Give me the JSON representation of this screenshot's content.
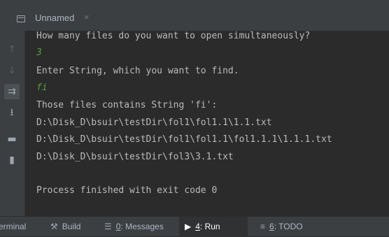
{
  "tab": {
    "title": "Unnamed",
    "close": "×"
  },
  "console": {
    "lines": [
      "How many files do you want to open simultaneously?",
      "3",
      "Enter String, which you want to find.",
      "fi",
      "Those files contains String 'fi':",
      "D:\\Disk_D\\bsuir\\testDir\\fol1\\fol1.1\\1.1.txt",
      "D:\\Disk_D\\bsuir\\testDir\\fol1\\fol1.1\\fol1.1.1\\1.1.1.txt",
      "D:\\Disk_D\\bsuir\\testDir\\fol3\\3.1.txt",
      "Process finished with exit code 0"
    ]
  },
  "bottom_bar": {
    "terminal": "erminal",
    "build": "Build",
    "messages_key": "0",
    "messages_rest": ": Messages",
    "run_key": "4",
    "run_rest": ": Run",
    "todo_key": "6",
    "todo_rest": ": TODO"
  },
  "colors": {
    "user_input": "#5a9e3b",
    "output": "#bbbbbb",
    "accent": "#4a88c7"
  }
}
